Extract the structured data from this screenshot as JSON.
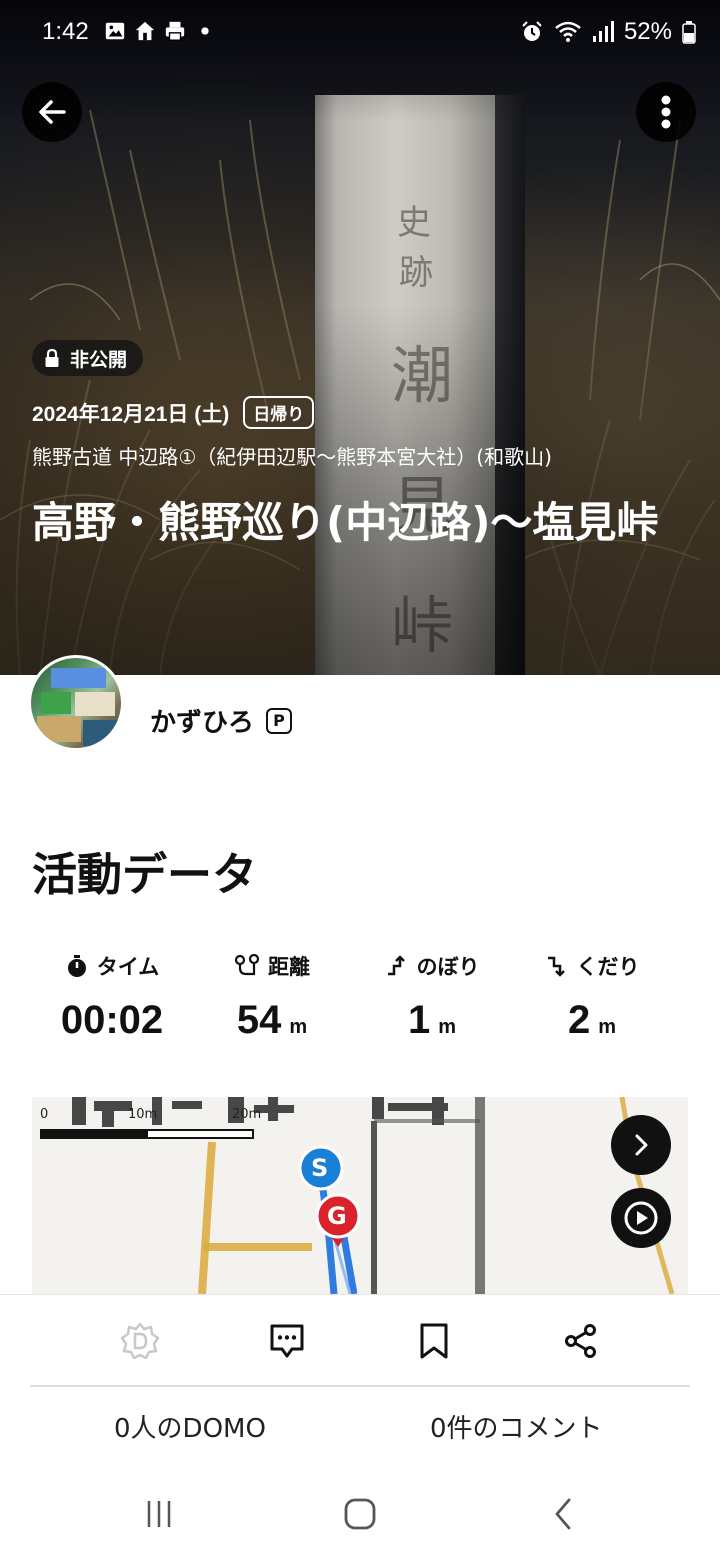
{
  "status_bar": {
    "time": "1:42",
    "battery": "52%",
    "left_icons": [
      "image-icon",
      "home-icon",
      "print-icon",
      "dot-icon"
    ],
    "right_icons": [
      "alarm-icon",
      "wifi-icon",
      "signal-icon",
      "battery-icon"
    ]
  },
  "hero": {
    "visibility_badge": "非公開",
    "date": "2024年12月21日 (土)",
    "trip_type": "日帰り",
    "route": "熊野古道 中辺路①（紀伊田辺駅～熊野本宮大社）(和歌山)",
    "title": "高野・熊野巡り(中辺路)～塩見峠"
  },
  "user": {
    "name": "かずひろ",
    "premium_badge": "P"
  },
  "activity": {
    "section_title": "活動データ",
    "stats": [
      {
        "label": "タイム",
        "value": "00:02",
        "unit": "",
        "icon": "stopwatch-icon"
      },
      {
        "label": "距離",
        "value": "54",
        "unit": "m",
        "icon": "distance-icon"
      },
      {
        "label": "のぼり",
        "value": "1",
        "unit": "m",
        "icon": "ascent-icon"
      },
      {
        "label": "くだり",
        "value": "2",
        "unit": "m",
        "icon": "descent-icon"
      }
    ]
  },
  "map": {
    "scale_labels": [
      "0",
      "10m",
      "20m"
    ],
    "start_marker": "S",
    "goal_marker": "G"
  },
  "actions": {
    "icons": [
      "domo-icon",
      "comment-icon",
      "bookmark-icon",
      "share-icon"
    ],
    "domo_count": "0人のDOMO",
    "comment_count": "0件のコメント"
  },
  "colors": {
    "start_marker": "#1a7fd6",
    "goal_marker": "#d9222a",
    "track": "#2f7be0",
    "map_road": "#d9a93a"
  }
}
